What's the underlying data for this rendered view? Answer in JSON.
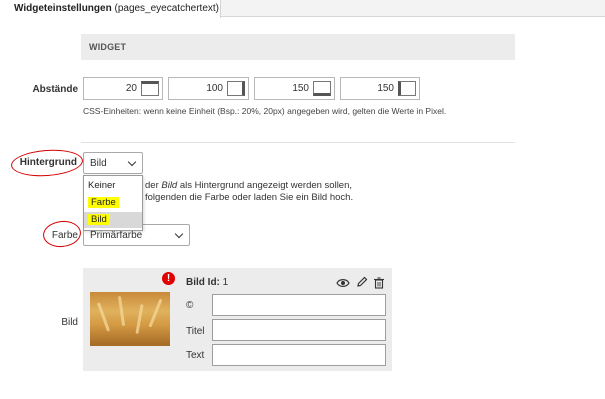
{
  "tab": {
    "title": "Widgeteinstellungen",
    "subtitle": "(pages_eyecatchertext)"
  },
  "section": {
    "title": "WIDGET"
  },
  "spacing": {
    "label": "Abstände",
    "values": [
      "20",
      "100",
      "150",
      "150"
    ],
    "icons": [
      "spacing-top-icon",
      "spacing-right-icon",
      "spacing-bottom-icon",
      "spacing-left-icon"
    ],
    "hint": "CSS-Einheiten: wenn keine Einheit (Bsp.: 20%, 20px) angegeben wird, gelten die Werte in Pixel."
  },
  "background": {
    "label": "Hintergrund",
    "selected": "Bild",
    "options": [
      "Keiner",
      "Farbe",
      "Bild"
    ],
    "highlighted": [
      "Farbe",
      "Bild"
    ],
    "info_line1_pre": "der ",
    "info_line1_em": "Bild",
    "info_line1_post": " als Hintergrund angezeigt werden sollen,",
    "info_line2": "folgenden die Farbe oder laden Sie ein Bild hoch."
  },
  "color": {
    "label": "Farbe",
    "selected": "Primärfarbe"
  },
  "image": {
    "label": "Bild",
    "id_label": "Bild Id:",
    "id_value": "1",
    "warning_glyph": "!",
    "fields": [
      {
        "label": "©",
        "value": ""
      },
      {
        "label": "Titel",
        "value": ""
      },
      {
        "label": "Text",
        "value": ""
      }
    ],
    "action_icons": [
      "eye-icon",
      "pencil-icon",
      "trash-icon"
    ]
  },
  "colors": {
    "annotation_red": "#d40000",
    "highlight_yellow": "#ffff00",
    "warning_red": "#e00000"
  }
}
